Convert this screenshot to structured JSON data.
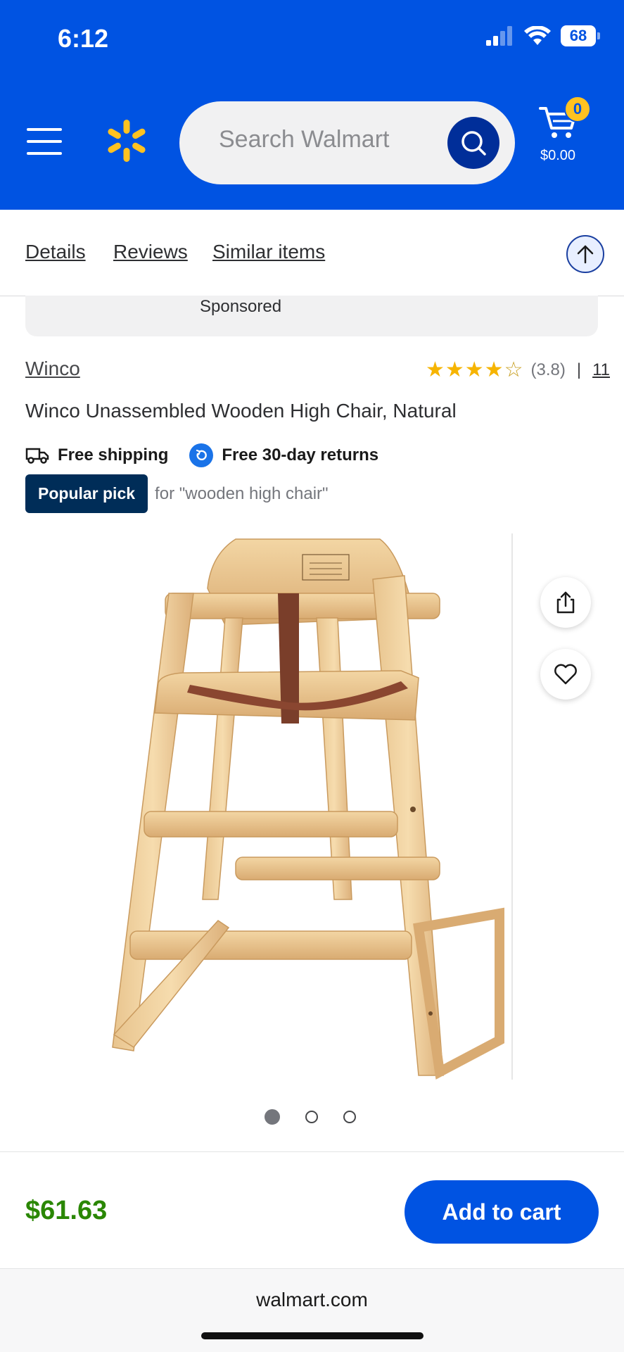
{
  "status_bar": {
    "time": "6:12",
    "battery": "68"
  },
  "header": {
    "search_placeholder": "Search Walmart",
    "cart_count": "0",
    "cart_total": "$0.00",
    "colors": {
      "brand_blue": "#0053e2",
      "spark_yellow": "#ffc220",
      "search_button": "#002e99"
    }
  },
  "section_nav": {
    "links": [
      "Details",
      "Reviews",
      "Similar items"
    ]
  },
  "sponsored": {
    "label": "Sponsored"
  },
  "product": {
    "brand": "Winco",
    "rating_value": "(3.8)",
    "rating_stars": 3.8,
    "review_count": "11",
    "title": "Winco Unassembled Wooden High Chair, Natural",
    "perks": [
      "Free shipping",
      "Free 30-day returns"
    ],
    "badge": "Popular pick",
    "badge_context": "for \"wooden high chair\"",
    "image_count": 3,
    "active_image": 1
  },
  "purchase": {
    "price": "$61.63",
    "add_to_cart": "Add to cart",
    "price_color": "#2a8703"
  },
  "browser": {
    "url": "walmart.com"
  }
}
